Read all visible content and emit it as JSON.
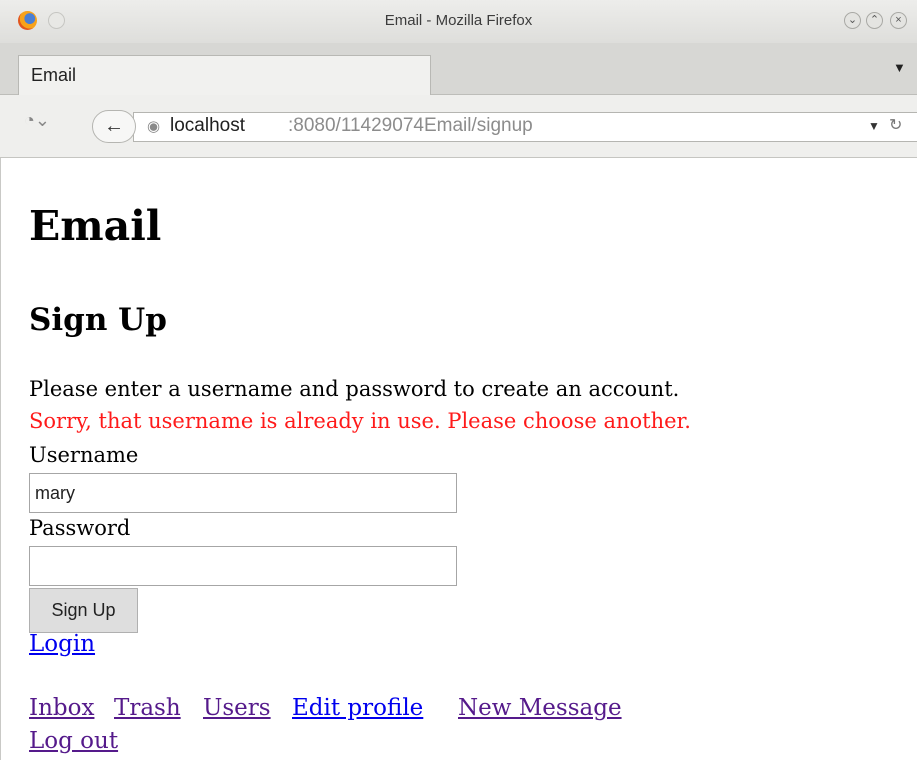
{
  "window": {
    "title": "Email - Mozilla Firefox"
  },
  "tab": {
    "label": "Email"
  },
  "nav": {
    "url_host": "localhost",
    "url_rest": ":8080/11429074Email/signup"
  },
  "page": {
    "heading": "Email",
    "subheading": "Sign Up",
    "intro": "Please enter a username and password to create an account.",
    "error": "Sorry, that username is already in use. Please choose another.",
    "username_label": "Username",
    "username_value": "mary",
    "password_label": "Password",
    "password_value": "",
    "submit_label": "Sign Up",
    "login_link": "Login",
    "footer_links": [
      "Inbox",
      "Trash",
      "Users",
      "Edit profile",
      "New Message",
      "Log out"
    ]
  },
  "colors": {
    "error": "#ff1a1a",
    "link": "#0000ee",
    "visited": "#551a8b"
  }
}
